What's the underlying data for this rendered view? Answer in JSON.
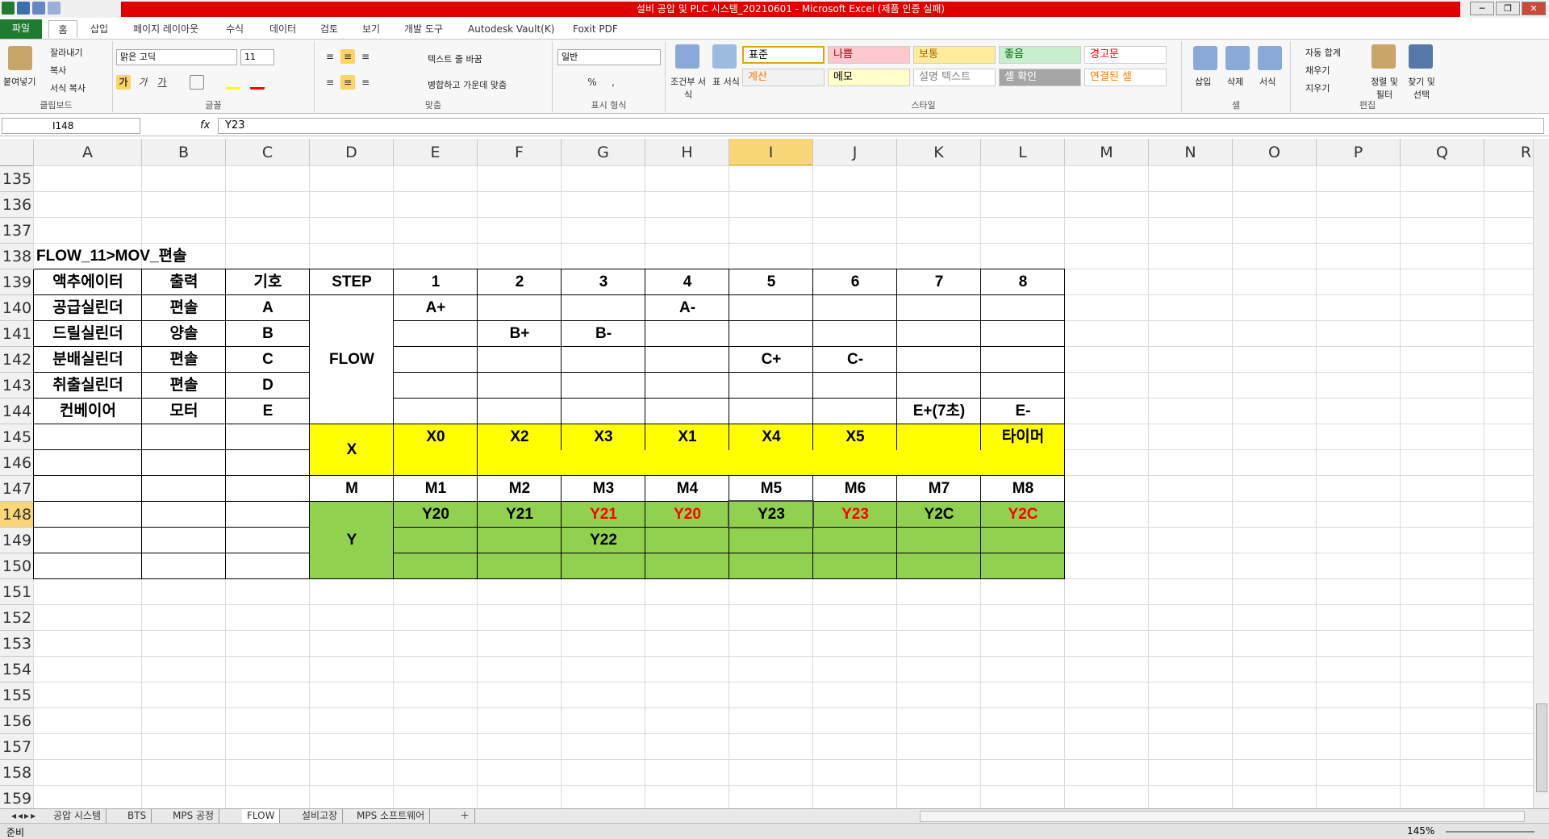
{
  "window": {
    "title": "설비 공압 및 PLC 시스템_20210601  -  Microsoft Excel (제품 인증 실패)",
    "controls": [
      "─",
      "❐",
      "✕"
    ]
  },
  "ribbon_tabs": [
    "파일",
    "홈",
    "삽입",
    "페이지 레이아웃",
    "수식",
    "데이터",
    "검토",
    "보기",
    "개발 도구",
    "Autodesk Vault(K)",
    "Foxit PDF"
  ],
  "ribbon": {
    "clipboard": {
      "paste": "붙여넣기",
      "cut": "잘라내기",
      "copy": "복사",
      "format_painter": "서식 복사",
      "group": "클립보드"
    },
    "font": {
      "name": "맑은 고딕",
      "size": "11",
      "bold": "가",
      "italic": "가",
      "underline": "가",
      "group": "글꼴"
    },
    "alignment": {
      "wrap": "텍스트 줄 바꿈",
      "merge": "병합하고 가운데 맞춤",
      "group": "맞춤"
    },
    "number": {
      "format": "일반",
      "percent": "%",
      "comma": ",",
      "group": "표시 형식"
    },
    "styles": {
      "conditional": "조건부 서식",
      "table": "표 서식",
      "cells": [
        {
          "label": "표준",
          "bg": "#ffffff",
          "fg": "#000000"
        },
        {
          "label": "나쁨",
          "bg": "#ffc7ce",
          "fg": "#9c0006"
        },
        {
          "label": "보통",
          "bg": "#ffeb9c",
          "fg": "#9c6500"
        },
        {
          "label": "좋음",
          "bg": "#c6efce",
          "fg": "#006100"
        },
        {
          "label": "경고문",
          "bg": "#ffffff",
          "fg": "#ff0000"
        },
        {
          "label": "계산",
          "bg": "#f2f2f2",
          "fg": "#fa7d00"
        },
        {
          "label": "메모",
          "bg": "#ffffcc",
          "fg": "#000000"
        },
        {
          "label": "설명 텍스트",
          "bg": "#ffffff",
          "fg": "#7f7f7f"
        },
        {
          "label": "셀 확인",
          "bg": "#a5a5a5",
          "fg": "#ffffff"
        },
        {
          "label": "연결된 셀",
          "bg": "#ffffff",
          "fg": "#fa7d00"
        }
      ],
      "group": "스타일"
    },
    "cells": {
      "insert": "삽입",
      "delete": "삭제",
      "format": "서식",
      "group": "셀"
    },
    "editing": {
      "autosum": "자동 합계",
      "fill": "채우기",
      "clear": "지우기",
      "sort": "정렬 및 필터",
      "find": "찾기 및 선택",
      "group": "편집"
    }
  },
  "formula_bar": {
    "name_box": "I148",
    "fx": "fx",
    "value": "Y23"
  },
  "columns": [
    "A",
    "B",
    "C",
    "D",
    "E",
    "F",
    "G",
    "H",
    "I",
    "J",
    "K",
    "L",
    "M",
    "N",
    "O",
    "P",
    "Q",
    "R"
  ],
  "rows": [
    "135",
    "136",
    "137",
    "138",
    "139",
    "140",
    "141",
    "142",
    "143",
    "144",
    "145",
    "146",
    "147",
    "148",
    "149",
    "150",
    "151",
    "152",
    "153",
    "154",
    "155",
    "156",
    "157",
    "158",
    "159"
  ],
  "selected": {
    "col": "I",
    "row": "148"
  },
  "sheet": {
    "title": "FLOW_11>MOV_편솔",
    "header": [
      "액추에이터",
      "출력",
      "기호",
      "STEP",
      "1",
      "2",
      "3",
      "4",
      "5",
      "6",
      "7",
      "8"
    ],
    "actuators": [
      {
        "name": "공급실린더",
        "output": "편솔",
        "symbol": "A"
      },
      {
        "name": "드릴실린더",
        "output": "양솔",
        "symbol": "B"
      },
      {
        "name": "분배실린더",
        "output": "편솔",
        "symbol": "C"
      },
      {
        "name": "취출실린더",
        "output": "편솔",
        "symbol": "D"
      },
      {
        "name": "컨베이어",
        "output": "모터",
        "symbol": "E"
      }
    ],
    "flow_label": "FLOW",
    "flow_steps": [
      {
        "row": 0,
        "step": 1,
        "text": "A+"
      },
      {
        "row": 0,
        "step": 4,
        "text": "A-"
      },
      {
        "row": 1,
        "step": 2,
        "text": "B+"
      },
      {
        "row": 1,
        "step": 3,
        "text": "B-"
      },
      {
        "row": 2,
        "step": 5,
        "text": "C+"
      },
      {
        "row": 2,
        "step": 6,
        "text": "C-"
      },
      {
        "row": 4,
        "step": 7,
        "text": "E+(7초)"
      },
      {
        "row": 4,
        "step": 8,
        "text": "E-"
      }
    ],
    "x_label": "X",
    "x_values": [
      "X0",
      "X2",
      "X3",
      "X1",
      "X4",
      "X5",
      "",
      "타이머"
    ],
    "m_label": "M",
    "m_values": [
      "M1",
      "M2",
      "M3",
      "M4",
      "M5",
      "M6",
      "M7",
      "M8"
    ],
    "y_label": "Y",
    "y_values": [
      {
        "text": "Y20",
        "color": "#000000"
      },
      {
        "text": "Y21",
        "color": "#000000"
      },
      {
        "text": "Y21",
        "color": "#ff0000"
      },
      {
        "text": "Y20",
        "color": "#ff0000"
      },
      {
        "text": "Y23",
        "color": "#000000"
      },
      {
        "text": "Y23",
        "color": "#ff0000"
      },
      {
        "text": "Y2C",
        "color": "#000000"
      },
      {
        "text": "Y2C",
        "color": "#ff0000"
      }
    ],
    "y_values_row2": [
      "",
      "",
      "Y22",
      "",
      "",
      "",
      "",
      ""
    ],
    "colors": {
      "x_fill": "#ffff00",
      "y_fill": "#92d050",
      "red_text": "#ff0000"
    }
  },
  "sheet_tabs": [
    "공압 시스템",
    "BTS",
    "MPS 공정",
    "FLOW",
    "설비고장",
    "MPS 소프트웨어"
  ],
  "active_sheet": "FLOW",
  "status": {
    "ready": "준비",
    "zoom": "145%"
  }
}
